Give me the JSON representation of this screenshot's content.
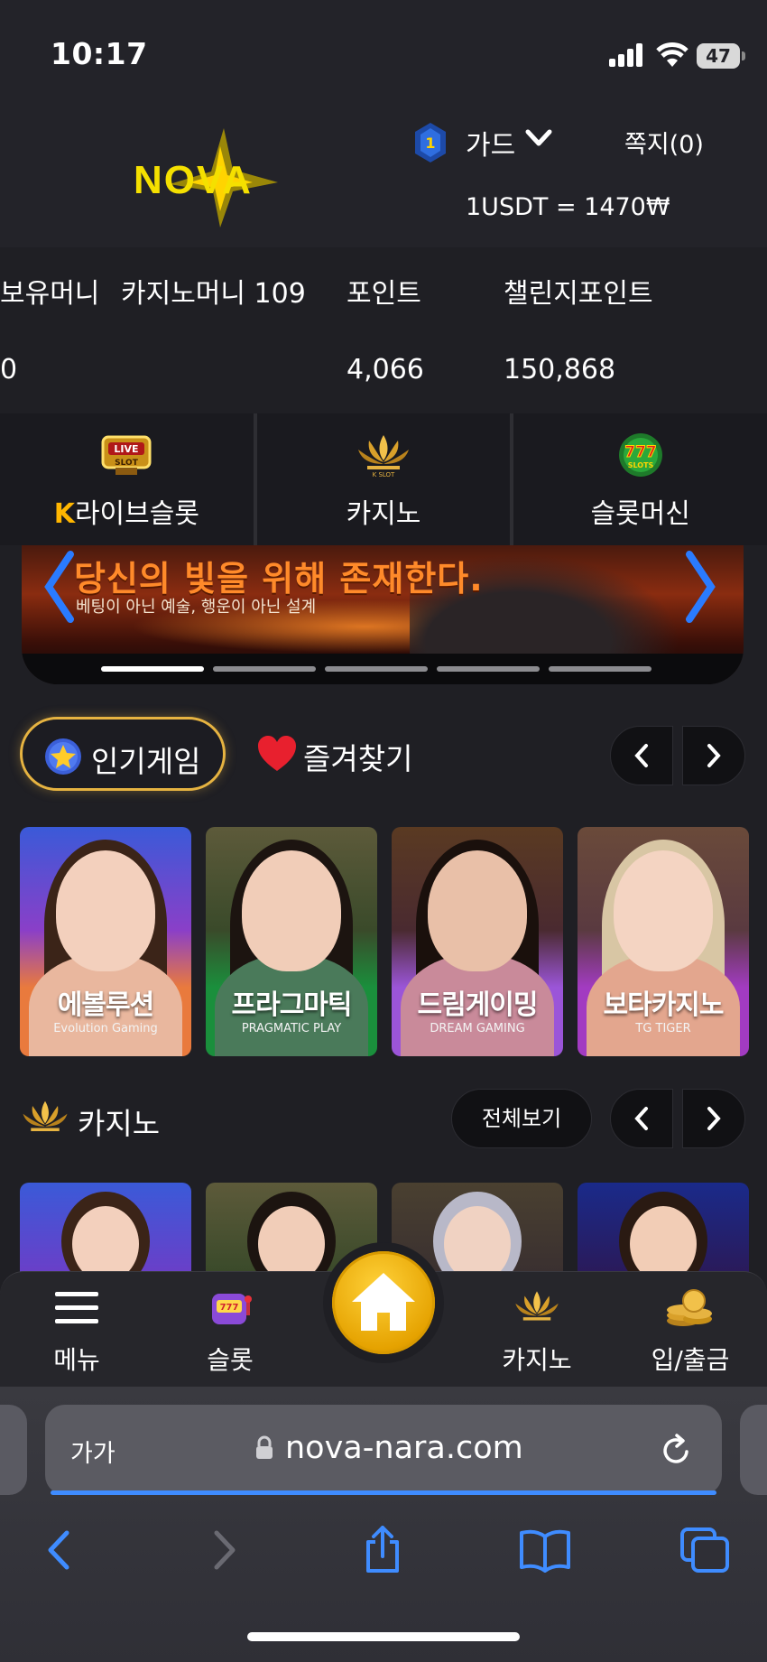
{
  "status_bar": {
    "time": "10:17",
    "battery": "47"
  },
  "header": {
    "logo_text": "NOVA",
    "rank_level": "1",
    "rank_name": "가드",
    "messages": "쪽지(0)",
    "exchange_rate": "1USDT = 1470₩"
  },
  "balance": {
    "holding_label": "보유머니",
    "casino_label": "카지노머니 109",
    "point_label": "포인트",
    "challenge_label": "챌린지포인트",
    "holding_value": "0",
    "point_value": "4,066",
    "challenge_value": "150,868"
  },
  "categories": [
    {
      "label": "라이브슬롯",
      "icon": "live-slot-icon",
      "badge": "LIVE SLOT",
      "prefix": "K"
    },
    {
      "label": "카지노",
      "icon": "k-slot-lotus-icon",
      "badge": "K SLOT"
    },
    {
      "label": "슬롯머신",
      "icon": "777-slots-icon",
      "badge": "777 SLOTS"
    }
  ],
  "banner": {
    "headline": "당신의 빛을 위해 존재한다.",
    "subline": "베팅이 아닌 예술, 행운이 아닌 설계",
    "slides": 5,
    "active_slide": 1
  },
  "popular": {
    "tab_label": "인기게임",
    "favorites_label": "즐겨찾기",
    "games": [
      {
        "title": "에볼루션",
        "provider": "Evolution Gaming",
        "color": "#e97a3d"
      },
      {
        "title": "프라그마틱",
        "provider": "PRAGMATIC PLAY",
        "color": "#1a8f3c"
      },
      {
        "title": "드림게이밍",
        "provider": "DREAM GAMING",
        "color": "#9b55d8"
      },
      {
        "title": "보타카지노",
        "provider": "TG TIGER",
        "color": "#a23bc1"
      }
    ]
  },
  "casino_section": {
    "title": "카지노",
    "all_label": "전체보기"
  },
  "bottom_nav": [
    {
      "label": "메뉴",
      "icon": "hamburger-icon"
    },
    {
      "label": "슬롯",
      "icon": "slot-machine-icon"
    },
    {
      "label": "",
      "icon": "home-icon"
    },
    {
      "label": "카지노",
      "icon": "k-slot-lotus-icon"
    },
    {
      "label": "입/출금",
      "icon": "gold-coins-icon"
    }
  ],
  "browser": {
    "text_size": "가가",
    "url": "nova-nara.com"
  },
  "colors": {
    "background": "#1f1f24",
    "accent_gold": "#e6b341",
    "link_blue": "#3f8cff"
  }
}
